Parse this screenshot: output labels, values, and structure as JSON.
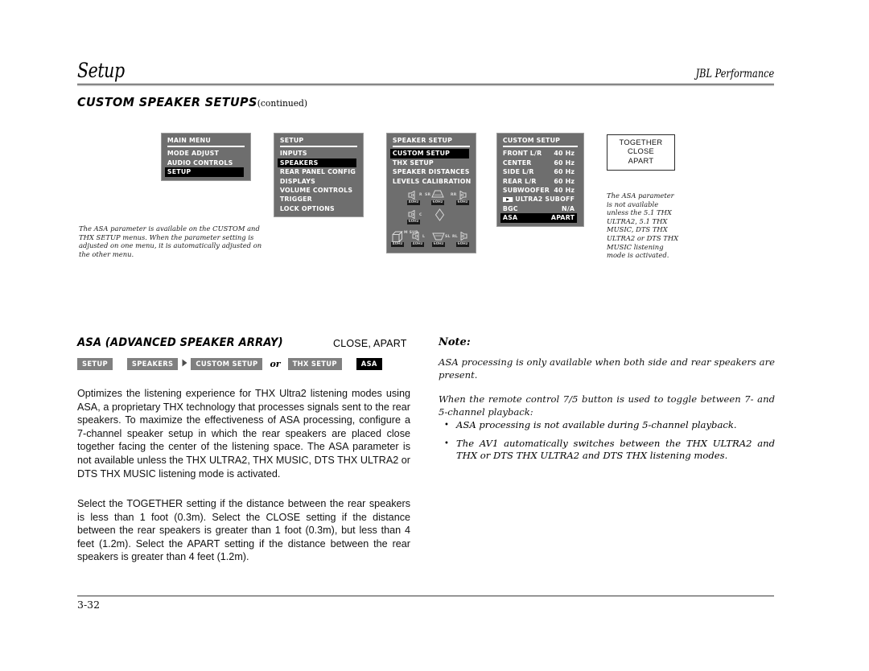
{
  "header": {
    "title": "Setup",
    "brand": "JBL Performance",
    "section_title": "CUSTOM SPEAKER SETUPS",
    "section_continued": "(continued)"
  },
  "osd_menus": {
    "main_menu": {
      "title": "MAIN MENU",
      "items": [
        {
          "label": "MODE ADJUST",
          "selected": false
        },
        {
          "label": "AUDIO CONTROLS",
          "selected": false
        },
        {
          "label": "SETUP",
          "selected": true
        }
      ]
    },
    "setup_menu": {
      "title": "SETUP",
      "items": [
        {
          "label": "INPUTS",
          "selected": false
        },
        {
          "label": "SPEAKERS",
          "selected": true
        },
        {
          "label": "REAR PANEL CONFIG",
          "selected": false
        },
        {
          "label": "DISPLAYS",
          "selected": false
        },
        {
          "label": "VOLUME CONTROLS",
          "selected": false
        },
        {
          "label": "TRIGGER",
          "selected": false
        },
        {
          "label": "LOCK OPTIONS",
          "selected": false
        }
      ]
    },
    "speaker_setup_menu": {
      "title": "SPEAKER SETUP",
      "items": [
        {
          "label": "CUSTOM SETUP",
          "selected": true
        },
        {
          "label": "THX SETUP",
          "selected": false
        },
        {
          "label": "SPEAKER DISTANCES",
          "selected": false
        },
        {
          "label": "LEVELS CALIBRATION",
          "selected": false
        }
      ],
      "diagram": {
        "speakers": [
          {
            "id": "right",
            "label": "R",
            "freq": "40Hz"
          },
          {
            "id": "surround",
            "label": "SR",
            "freq": "60Hz"
          },
          {
            "id": "rear-right",
            "label": "RR",
            "freq": "60Hz"
          },
          {
            "id": "center",
            "label": "C",
            "freq": "60Hz"
          },
          {
            "id": "subwoofer",
            "label": "M SUB",
            "freq": "40Hz"
          },
          {
            "id": "left",
            "label": "L",
            "freq": "40Hz"
          },
          {
            "id": "side-left",
            "label": "SL",
            "freq": "60Hz"
          },
          {
            "id": "rear-left",
            "label": "RL",
            "freq": "60Hz"
          }
        ]
      }
    },
    "custom_setup_menu": {
      "title": "CUSTOM SETUP",
      "rows": [
        {
          "label": "FRONT L/R",
          "value": "40 Hz",
          "selected": false,
          "icon": ""
        },
        {
          "label": "CENTER",
          "value": "60 Hz",
          "selected": false,
          "icon": ""
        },
        {
          "label": "SIDE L/R",
          "value": "60 Hz",
          "selected": false,
          "icon": ""
        },
        {
          "label": "REAR L/R",
          "value": "60 Hz",
          "selected": false,
          "icon": ""
        },
        {
          "label": "SUBWOOFER",
          "value": "40 Hz",
          "selected": false,
          "icon": ""
        },
        {
          "label": "ULTRA2 SUB",
          "value": "OFF",
          "selected": false,
          "icon": "play-arrow-icon"
        },
        {
          "label": "BGC",
          "value": "N/A",
          "selected": false,
          "icon": ""
        },
        {
          "label": "ASA",
          "value": "APART",
          "selected": true,
          "icon": ""
        }
      ]
    }
  },
  "settings_box": {
    "options": [
      "TOGETHER",
      "CLOSE",
      "APART"
    ]
  },
  "captions": {
    "left": "The ASA parameter is available on the CUSTOM and THX SETUP menus. When the parameter setting is adjusted on one menu, it is automatically adjusted on the other menu.",
    "right": "The ASA parameter is not available unless the 5.1 THX ULTRA2, 5.1 THX MUSIC, DTS THX ULTRA2 or DTS THX MUSIC listening mode is activated."
  },
  "asa_section": {
    "heading": "ASA (ADVANCED SPEAKER ARRAY)",
    "setting_values": "CLOSE, APART",
    "breadcrumbs": [
      {
        "label": "SETUP",
        "style": "gray"
      },
      {
        "label": "SPEAKERS",
        "style": "gray"
      },
      {
        "label": "CUSTOM SETUP",
        "style": "gray"
      },
      {
        "label": "THX SETUP",
        "style": "gray"
      },
      {
        "label": "ASA",
        "style": "black"
      }
    ],
    "breadcrumb_or": "or",
    "paragraph_1": "Optimizes the listening experience for THX Ultra2 listening modes using ASA, a proprietary THX technology that processes signals sent to the rear speakers. To maximize the effectiveness of ASA processing, configure a 7-channel speaker setup in which the rear speakers are placed close together facing the center of the listening space. The ASA parameter is not available unless the THX ULTRA2, THX MUSIC, DTS THX ULTRA2 or DTS THX MUSIC listening mode is activated.",
    "paragraph_2": "Select the TOGETHER setting if the distance between the rear speakers is less than 1 foot (0.3m). Select the CLOSE setting if the distance between the rear speakers is greater than 1 foot (0.3m), but less than 4 feet (1.2m). Select the APART setting if the distance between the rear speakers is greater than 4 feet (1.2m)."
  },
  "note": {
    "label": "Note:",
    "paragraph_1": "ASA processing is only available when both side and rear speakers are present.",
    "paragraph_2": "When the remote control 7/5 button is used to toggle between 7- and 5-channel playback:",
    "bullets": [
      "ASA processing is not available during 5-channel playback.",
      "The AV1 automatically switches between the THX ULTRA2 and THX or DTS THX ULTRA2 and DTS THX listening modes."
    ]
  },
  "footer": {
    "page_number": "3-32"
  }
}
